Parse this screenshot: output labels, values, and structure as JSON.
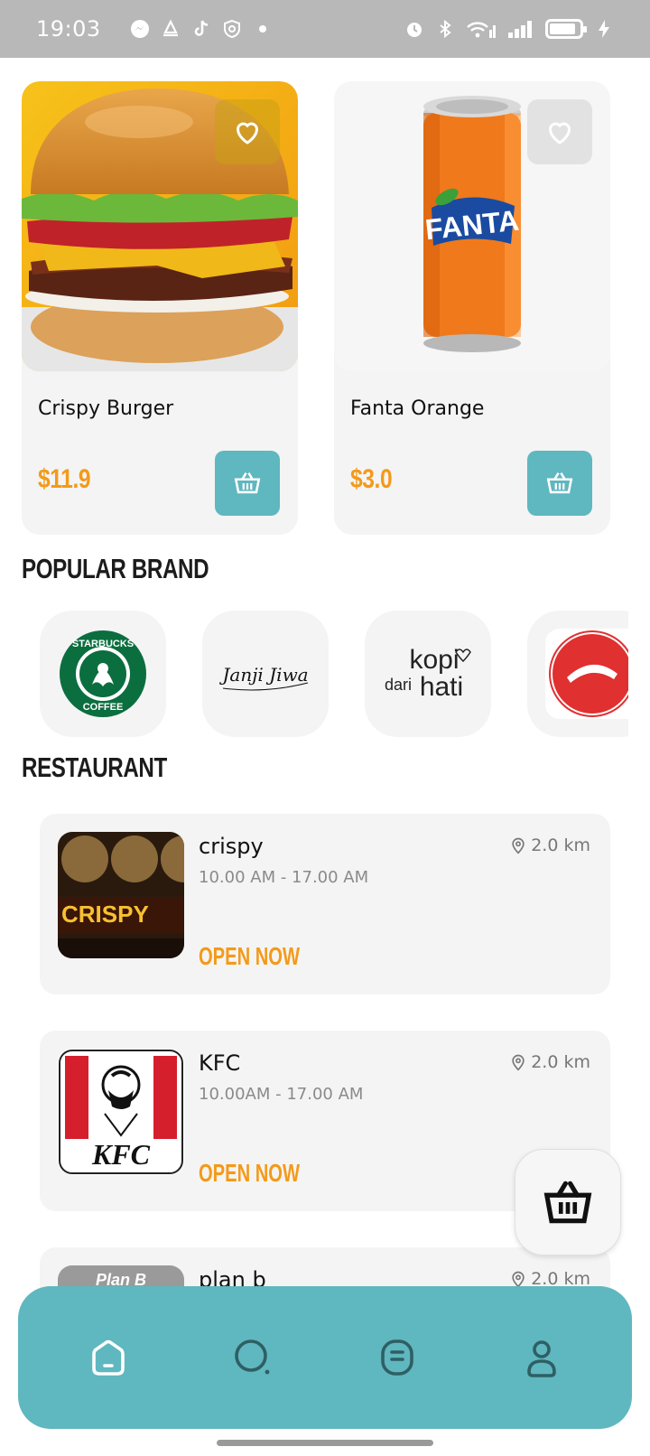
{
  "status_bar": {
    "time": "19:03",
    "left_icons": [
      "messenger-icon",
      "notification-icon",
      "tiktok-icon",
      "shield-icon",
      "dot-icon"
    ],
    "right_icons": [
      "alarm-icon",
      "bluetooth-icon",
      "wifi-icon",
      "signal-icon",
      "signal-icon",
      "battery-icon",
      "charging-icon"
    ],
    "battery_level": 0.9
  },
  "products": [
    {
      "name": "Crispy Burger",
      "price": "$11.9",
      "image": "burger-photo",
      "favorite_icon": "heart-icon",
      "cart_icon": "basket-icon"
    },
    {
      "name": "Fanta Orange",
      "price": "$3.0",
      "image": "fanta-can-photo",
      "favorite_icon": "heart-icon",
      "cart_icon": "basket-icon"
    }
  ],
  "sections": {
    "popular_brand": "POPULAR BRAND",
    "restaurant": "RESTAURANT"
  },
  "brands": [
    {
      "name": "Starbucks Coffee",
      "logo": "starbucks-logo",
      "logo_text_top": "STARBUCKS",
      "logo_text_bottom": "COFFEE"
    },
    {
      "name": "Janji Jiwa",
      "logo": "janji-jiwa-logo",
      "logo_text": "Janji Jiwa"
    },
    {
      "name": "Kopi dari Hati",
      "logo": "kopi-dari-hati-logo",
      "logo_text_top": "kopi",
      "logo_text_mid": "dari",
      "logo_text_bottom": "hati"
    },
    {
      "name": "Pizza Hut",
      "logo": "pizza-hut-logo"
    }
  ],
  "restaurants": [
    {
      "name": "crispy",
      "hours": "10.00 AM - 17.00 AM",
      "distance": "2.0 km",
      "status": "OPEN NOW",
      "thumbnail": "crispy-storefront-photo",
      "thumb_text": "CRISPY"
    },
    {
      "name": "KFC",
      "hours": "10.00AM - 17.00 AM",
      "distance": "2.0 km",
      "status": "OPEN NOW",
      "thumbnail": "kfc-logo",
      "thumb_text": "KFC"
    },
    {
      "name": "plan b",
      "hours": "",
      "distance": "2.0 km",
      "status": "",
      "thumbnail": "plan-b-storefront-photo",
      "thumb_text": "Plan B"
    }
  ],
  "floating_cart": {
    "icon": "basket-icon"
  },
  "bottom_nav": [
    {
      "icon": "home-icon",
      "active": true
    },
    {
      "icon": "search-icon",
      "active": false
    },
    {
      "icon": "orders-icon",
      "active": false
    },
    {
      "icon": "profile-icon",
      "active": false
    }
  ],
  "colors": {
    "accent_teal": "#5fb7bf",
    "price_orange": "#f39a1a",
    "card_background": "#f4f4f4",
    "status_bar": "#b8b8b8"
  }
}
